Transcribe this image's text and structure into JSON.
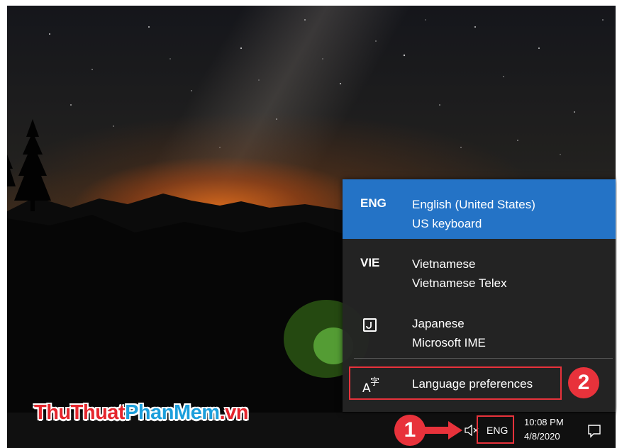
{
  "brand": {
    "part1": "ThuThuat",
    "part2": "PhanMem",
    "part3": ".vn"
  },
  "language_flyout": {
    "items": [
      {
        "code": "ENG",
        "language": "English (United States)",
        "keyboard": "US keyboard",
        "selected": true
      },
      {
        "code": "VIE",
        "language": "Vietnamese",
        "keyboard": "Vietnamese Telex",
        "selected": false
      },
      {
        "code": "",
        "icon": "japanese-ime-icon",
        "language": "Japanese",
        "keyboard": "Microsoft IME",
        "selected": false
      }
    ],
    "preferences_label": "Language preferences",
    "preferences_icon": "language-preferences-icon"
  },
  "taskbar": {
    "language_indicator": "ENG",
    "time": "10:08 PM",
    "date": "4/8/2020",
    "volume_icon": "volume-muted-icon",
    "notification_icon": "action-center-icon"
  },
  "annotations": {
    "step1": "1",
    "step2": "2"
  },
  "colors": {
    "accent": "#2473c6",
    "annotation_red": "#e8323b"
  }
}
